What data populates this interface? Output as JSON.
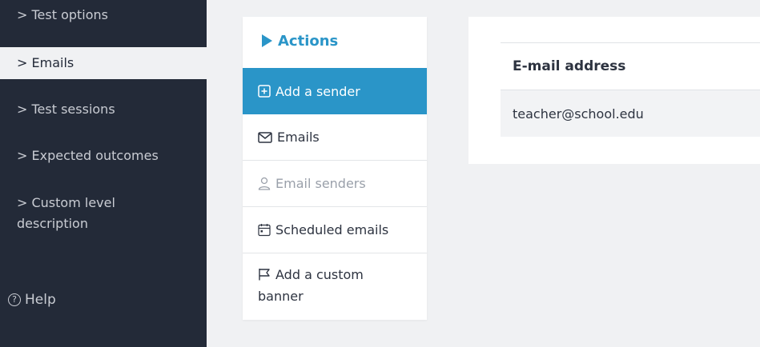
{
  "sidebar": {
    "items": [
      {
        "label": "> Test options"
      },
      {
        "label": "> Emails"
      },
      {
        "label": "> Test sessions"
      },
      {
        "label": "> Expected outcomes"
      },
      {
        "label": "> Custom level"
      },
      {
        "label": "description"
      }
    ],
    "help_label": "Help",
    "help_icon": "question-circle-icon"
  },
  "actions": {
    "title": "Actions",
    "title_icon": "play-icon",
    "items": [
      {
        "label": "Add a sender",
        "icon": "plus-square-icon"
      },
      {
        "label": "Emails",
        "icon": "envelope-icon"
      },
      {
        "label": "Email senders",
        "icon": "user-icon"
      },
      {
        "label": "Scheduled emails",
        "icon": "calendar-icon"
      },
      {
        "label": "Add a custom",
        "icon": "flag-icon"
      },
      {
        "label": "banner"
      }
    ]
  },
  "table": {
    "header": "E-mail address",
    "rows": [
      {
        "email": "teacher@school.edu"
      }
    ]
  },
  "colors": {
    "sidebar_bg": "#232a38",
    "accent": "#2a95c8",
    "page_bg": "#f0f1f3"
  }
}
